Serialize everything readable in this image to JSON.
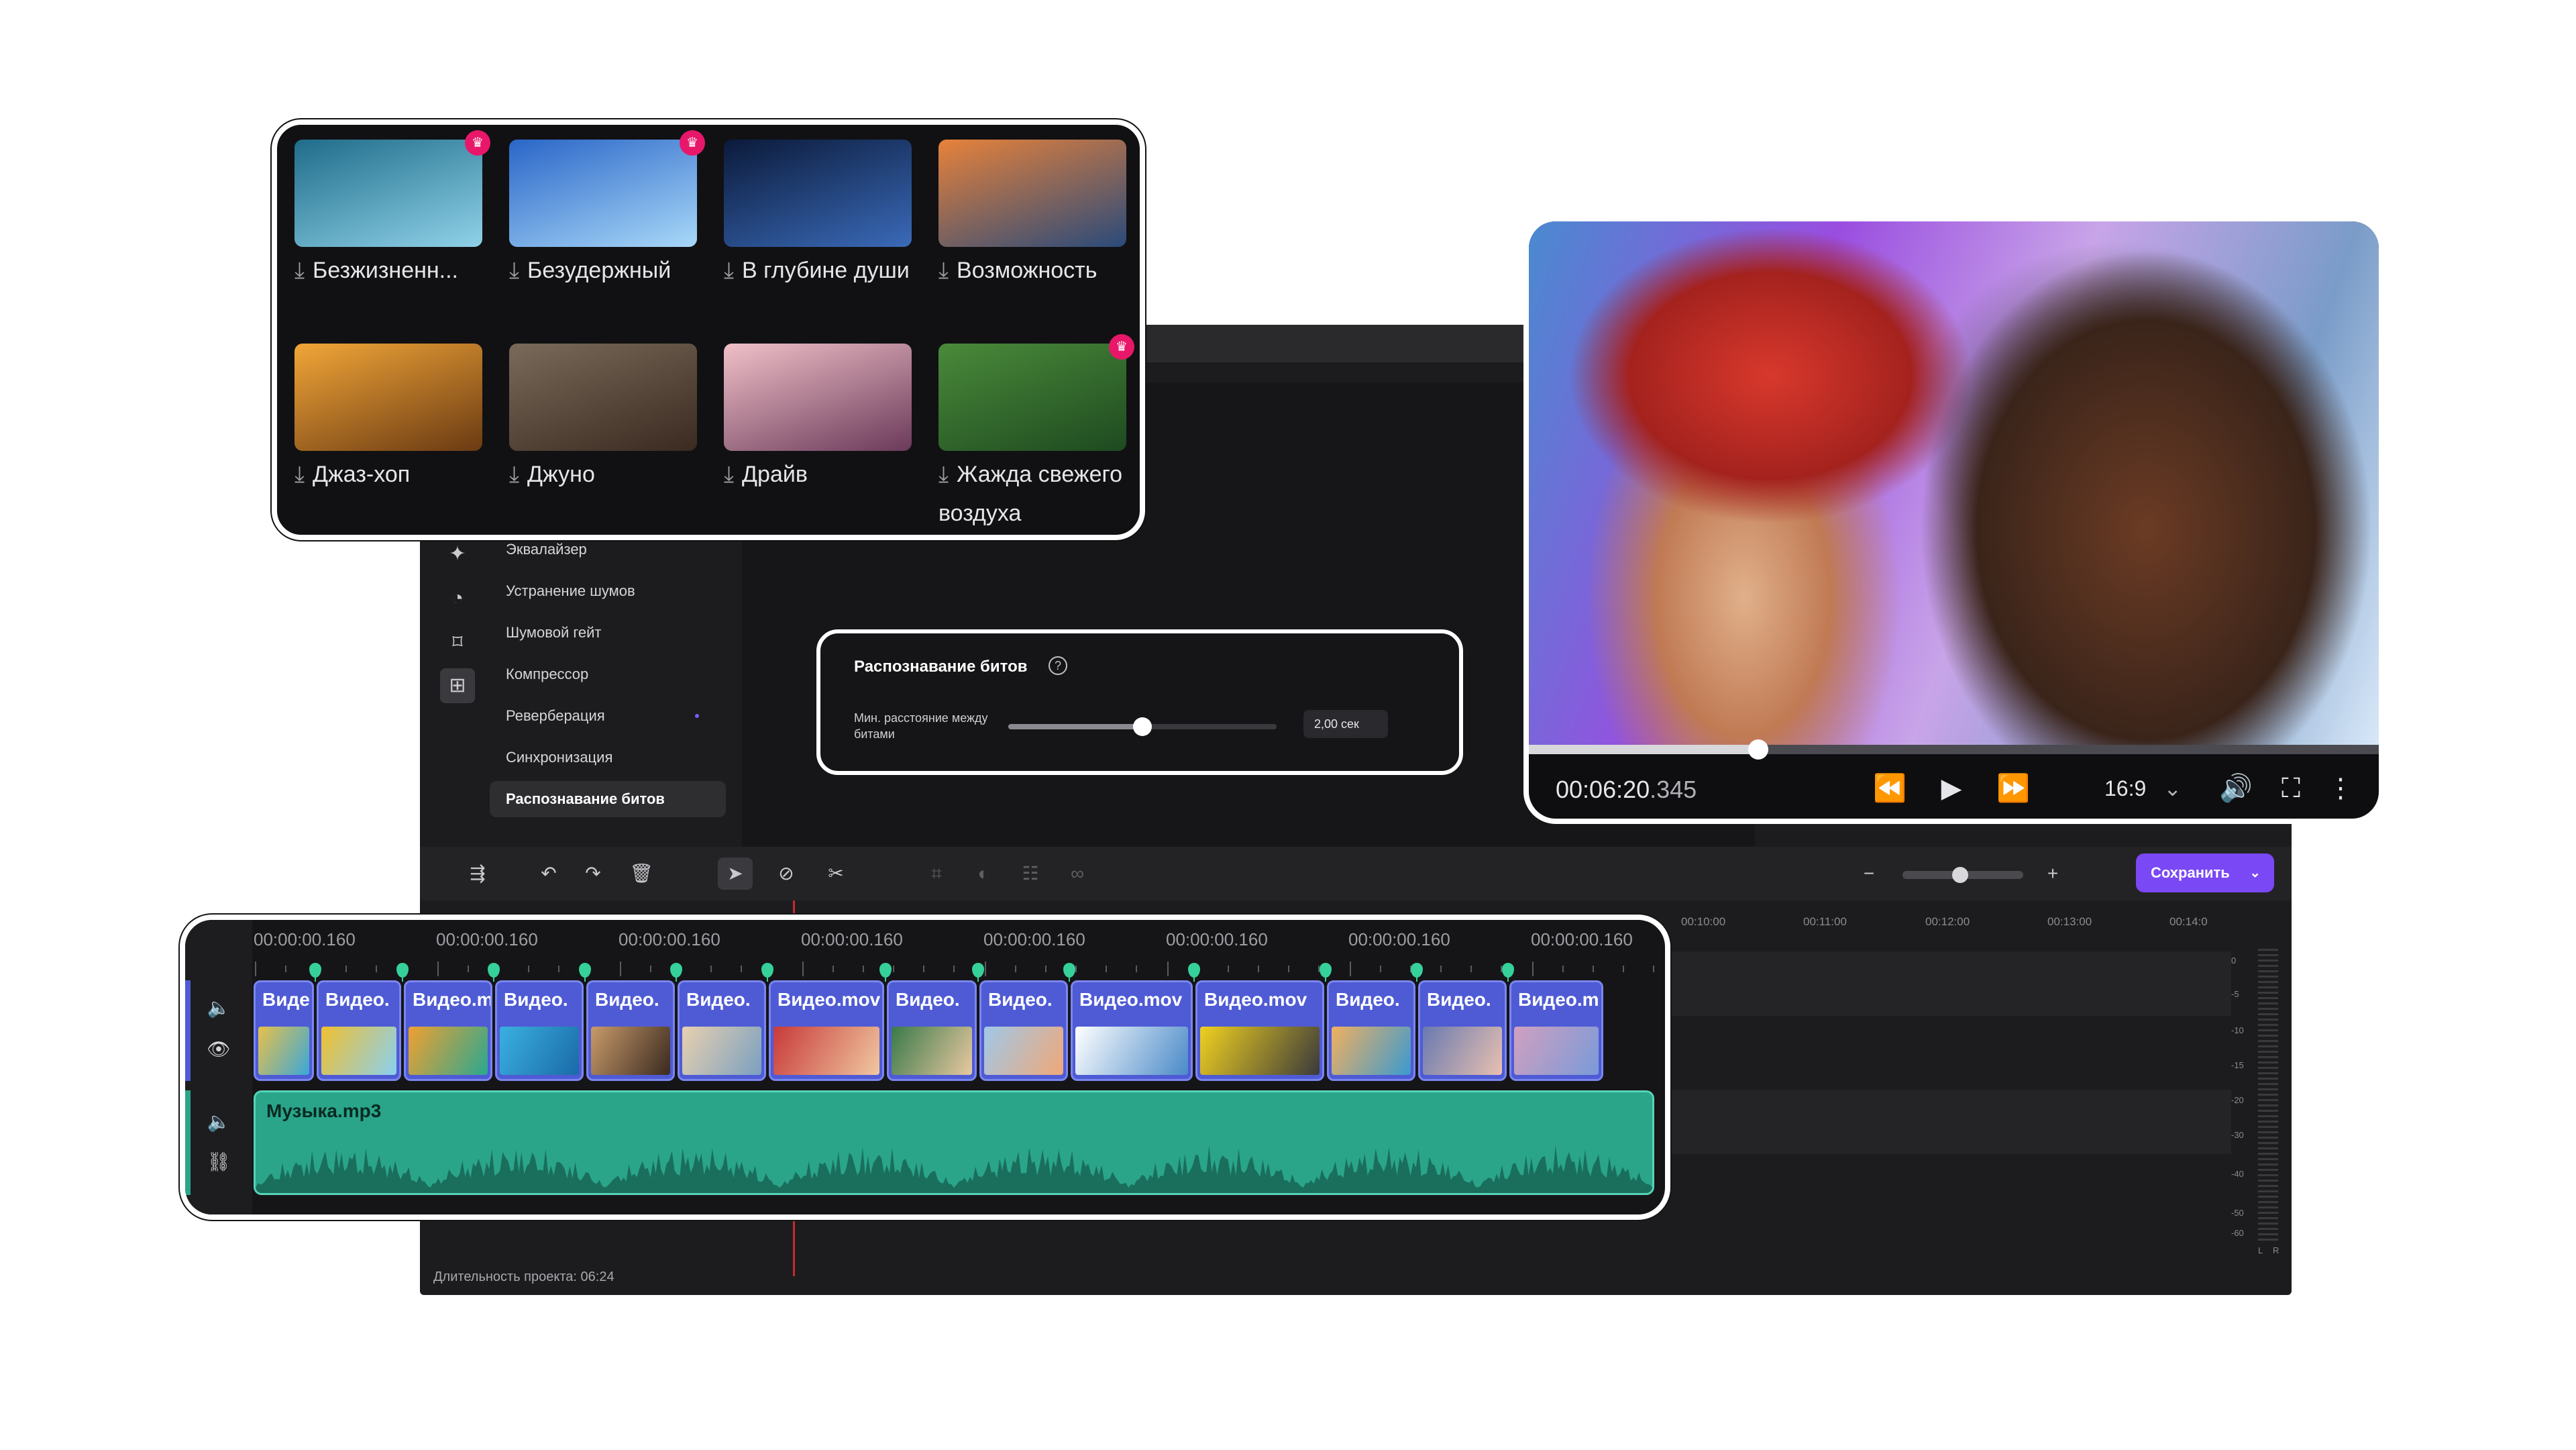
{
  "library": {
    "items": [
      {
        "label": "Безжизненн...",
        "premium": true,
        "g1": "#1f6c8a",
        "g2": "#8fd2e8"
      },
      {
        "label": "Безудержный",
        "premium": true,
        "g1": "#2a66c8",
        "g2": "#a8d8f8"
      },
      {
        "label": "В глубине души",
        "premium": false,
        "g1": "#0b1a3a",
        "g2": "#3a6ab8"
      },
      {
        "label": "Возможность",
        "premium": false,
        "g1": "#e8823a",
        "g2": "#2a4a7a"
      },
      {
        "label": "Джаз-хоп",
        "premium": false,
        "g1": "#f2a638",
        "g2": "#6a3a12"
      },
      {
        "label": "Джуно",
        "premium": false,
        "g1": "#7a6a5a",
        "g2": "#3a2a20"
      },
      {
        "label": "Драйв",
        "premium": false,
        "g1": "#f0c0c8",
        "g2": "#6a3a5a"
      },
      {
        "label": "Жажда свежего воздуха",
        "premium": true,
        "g1": "#4a8a3a",
        "g2": "#1e4a20"
      }
    ]
  },
  "sidebar": {
    "items": [
      "Эквалайзер",
      "Устранение шумов",
      "Шумовой гейт",
      "Компрессор",
      "Реверберация",
      "Синхронизация",
      "Распознавание битов"
    ],
    "active": "Распознавание битов"
  },
  "beat_panel": {
    "title": "Распознавание битов",
    "help_icon": "?",
    "label": "Мин. расстояние между битами",
    "value_text": "2,00 сек",
    "slider_fraction": 0.5
  },
  "toolbar": {
    "save_label": "Сохранить",
    "zoom_minus": "−",
    "zoom_plus": "+"
  },
  "ruler": {
    "labels": [
      "00:10:00",
      "00:11:00",
      "00:12:00",
      "00:13:00",
      "00:14:0"
    ]
  },
  "meter": {
    "labels": [
      "0",
      "-5",
      "-10",
      "-15",
      "-20",
      "-30",
      "-40",
      "-50",
      "-60",
      "L",
      "R"
    ]
  },
  "project": {
    "duration": "Длительность проекта: 06:24"
  },
  "player": {
    "time_main": "00:06:20",
    "time_ms": ".345",
    "aspect": "16:9",
    "progress_fraction": 0.27
  },
  "timeline": {
    "time_labels": [
      "00:00:00.160",
      "00:00:00.160",
      "00:00:00.160",
      "00:00:00.160",
      "00:00:00.160",
      "00:00:00.160",
      "00:00:00.160",
      "00:00:00.160"
    ],
    "clips": [
      {
        "title": "Виде",
        "c1": "#e8c04a",
        "c2": "#3aa8d8"
      },
      {
        "title": "Видео.",
        "c1": "#f0c030",
        "c2": "#8ad0f0"
      },
      {
        "title": "Видео.m",
        "c1": "#f0a030",
        "c2": "#2aa890"
      },
      {
        "title": "Видео.",
        "c1": "#3ab0e0",
        "c2": "#1a6aa8"
      },
      {
        "title": "Видео.",
        "c1": "#c89a6a",
        "c2": "#3a2a20"
      },
      {
        "title": "Видео.",
        "c1": "#e8d0b0",
        "c2": "#7aa0c0"
      },
      {
        "title": "Видео.mov",
        "c1": "#c83a3a",
        "c2": "#f0c8a0"
      },
      {
        "title": "Видео.",
        "c1": "#3a7a4a",
        "c2": "#e8c8a0"
      },
      {
        "title": "Видео.",
        "c1": "#a0c8e8",
        "c2": "#f0a878"
      },
      {
        "title": "Видео.mov",
        "c1": "#ffffff",
        "c2": "#4a8ac8"
      },
      {
        "title": "Видео.mov",
        "c1": "#f0d020",
        "c2": "#3a3a3a"
      },
      {
        "title": "Видео.",
        "c1": "#f0b060",
        "c2": "#3a9ad0"
      },
      {
        "title": "Видео.",
        "c1": "#6a7ab0",
        "c2": "#e8c0b0"
      },
      {
        "title": "Видео.m",
        "c1": "#d0a0c0",
        "c2": "#7a9ad8"
      }
    ],
    "music_title": "Музыка.mp3",
    "colors": {
      "video": "#4f5bd5",
      "music": "#2aa58a",
      "marker": "#36d19a"
    }
  }
}
